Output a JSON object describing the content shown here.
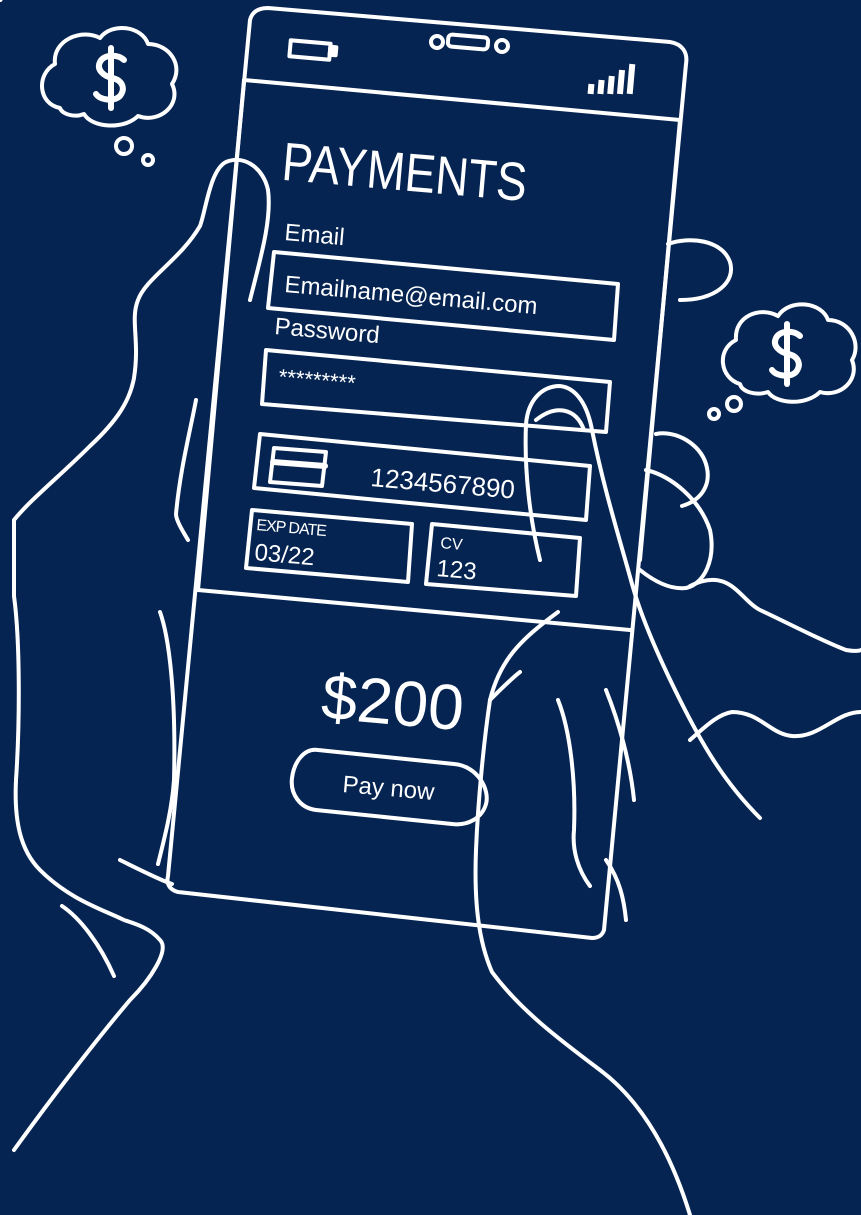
{
  "colors": {
    "background": "#062452",
    "line": "#ffffff"
  },
  "icons": [
    "dollar-thought-bubble-icon",
    "battery-icon",
    "speaker-camera-icon",
    "signal-bars-icon",
    "credit-card-icon"
  ],
  "screen": {
    "title": "PAYMENTS",
    "email": {
      "label": "Email",
      "value": "Emailname@email.com"
    },
    "password": {
      "label": "Password",
      "value": "*********"
    },
    "card": {
      "number": "1234567890"
    },
    "exp": {
      "label": "EXP DATE",
      "value": "03/22"
    },
    "cvv": {
      "label": "CV",
      "value": "123"
    },
    "amount": "$200",
    "pay_button": "Pay now"
  },
  "thought_bubbles": [
    {
      "symbol": "$"
    },
    {
      "symbol": "$"
    }
  ]
}
